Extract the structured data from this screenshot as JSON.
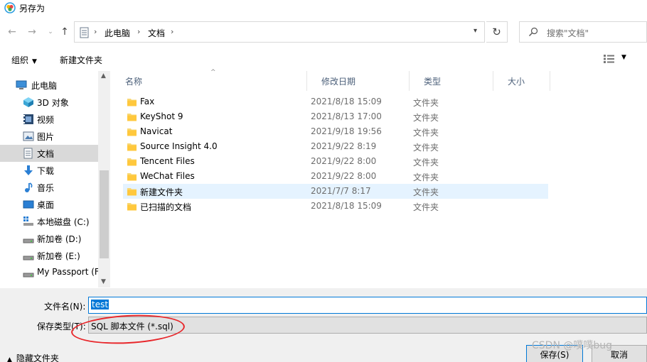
{
  "title": "另存为",
  "address": {
    "crumbs": [
      "此电脑",
      "文档"
    ]
  },
  "search": {
    "placeholder": "搜索\"文档\""
  },
  "toolbar": {
    "organize": "组织",
    "new_folder": "新建文件夹"
  },
  "sidebar": {
    "items": [
      {
        "label": "此电脑",
        "icon": "computer-icon"
      },
      {
        "label": "3D 对象",
        "icon": "cube-3d-icon"
      },
      {
        "label": "视频",
        "icon": "video-icon"
      },
      {
        "label": "图片",
        "icon": "picture-icon"
      },
      {
        "label": "文档",
        "icon": "document-icon"
      },
      {
        "label": "下载",
        "icon": "download-icon"
      },
      {
        "label": "音乐",
        "icon": "music-icon"
      },
      {
        "label": "桌面",
        "icon": "desktop-icon"
      },
      {
        "label": "本地磁盘 (C:)",
        "icon": "local-disk-icon"
      },
      {
        "label": "新加卷 (D:)",
        "icon": "drive-icon"
      },
      {
        "label": "新加卷 (E:)",
        "icon": "drive-icon"
      },
      {
        "label": "My Passport (F",
        "icon": "drive-icon"
      }
    ]
  },
  "columns": {
    "name": "名称",
    "date": "修改日期",
    "type": "类型",
    "size": "大小"
  },
  "files": [
    {
      "name": "Fax",
      "date": "2021/8/18 15:09",
      "type": "文件夹"
    },
    {
      "name": "KeyShot 9",
      "date": "2021/8/13 17:00",
      "type": "文件夹"
    },
    {
      "name": "Navicat",
      "date": "2021/9/18 19:56",
      "type": "文件夹"
    },
    {
      "name": "Source Insight 4.0",
      "date": "2021/9/22 8:19",
      "type": "文件夹"
    },
    {
      "name": "Tencent Files",
      "date": "2021/9/22 8:00",
      "type": "文件夹"
    },
    {
      "name": "WeChat Files",
      "date": "2021/9/22 8:00",
      "type": "文件夹"
    },
    {
      "name": "新建文件夹",
      "date": "2021/7/7 8:17",
      "type": "文件夹"
    },
    {
      "name": "已扫描的文档",
      "date": "2021/8/18 15:09",
      "type": "文件夹"
    }
  ],
  "form": {
    "filename_label": "文件名(N):",
    "filename_value": "test",
    "filetype_label": "保存类型(T):",
    "filetype_value": "SQL 脚本文件 (*.sql)"
  },
  "footer": {
    "hide_folders": "隐藏文件夹",
    "save": "保存(S)",
    "cancel": "取消"
  },
  "watermark": "CSDN @噗噗bug",
  "colors": {
    "accent": "#0078d7",
    "folder": "#f8d775",
    "annotation": "#e8262a"
  }
}
